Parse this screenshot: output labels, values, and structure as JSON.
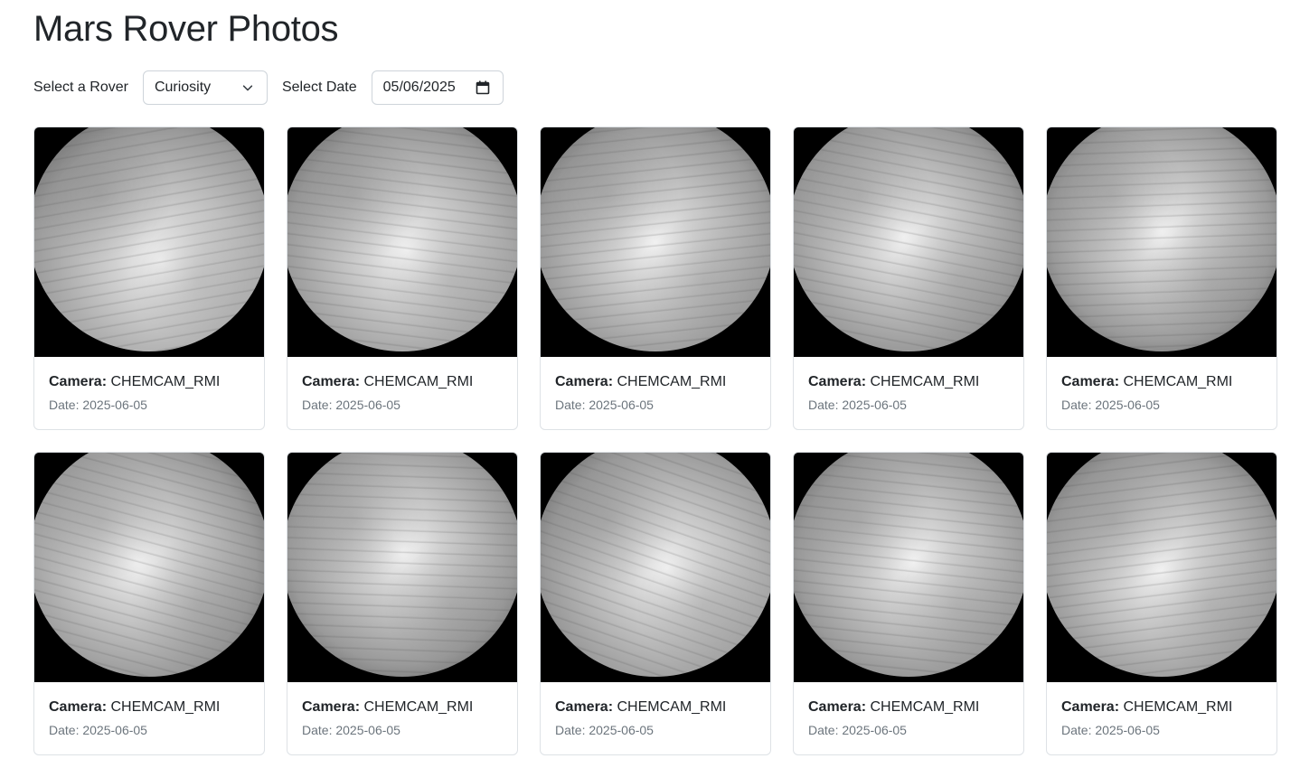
{
  "page": {
    "title": "Mars Rover Photos"
  },
  "controls": {
    "rover_label": "Select a Rover",
    "rover_selected": "Curiosity",
    "date_label": "Select Date",
    "date_value": "05/06/2025"
  },
  "photos": [
    {
      "camera_label": "Camera:",
      "camera": "CHEMCAM_RMI",
      "date": "Date: 2025-06-05"
    },
    {
      "camera_label": "Camera:",
      "camera": "CHEMCAM_RMI",
      "date": "Date: 2025-06-05"
    },
    {
      "camera_label": "Camera:",
      "camera": "CHEMCAM_RMI",
      "date": "Date: 2025-06-05"
    },
    {
      "camera_label": "Camera:",
      "camera": "CHEMCAM_RMI",
      "date": "Date: 2025-06-05"
    },
    {
      "camera_label": "Camera:",
      "camera": "CHEMCAM_RMI",
      "date": "Date: 2025-06-05"
    },
    {
      "camera_label": "Camera:",
      "camera": "CHEMCAM_RMI",
      "date": "Date: 2025-06-05"
    },
    {
      "camera_label": "Camera:",
      "camera": "CHEMCAM_RMI",
      "date": "Date: 2025-06-05"
    },
    {
      "camera_label": "Camera:",
      "camera": "CHEMCAM_RMI",
      "date": "Date: 2025-06-05"
    },
    {
      "camera_label": "Camera:",
      "camera": "CHEMCAM_RMI",
      "date": "Date: 2025-06-05"
    },
    {
      "camera_label": "Camera:",
      "camera": "CHEMCAM_RMI",
      "date": "Date: 2025-06-05"
    }
  ],
  "icons": {
    "rover_dropdown": "chevron-down-icon",
    "date_picker": "calendar-icon"
  },
  "colors": {
    "text": "#212529",
    "muted": "#6c757d",
    "border": "#dee2e6",
    "input_border": "#ced4da"
  }
}
